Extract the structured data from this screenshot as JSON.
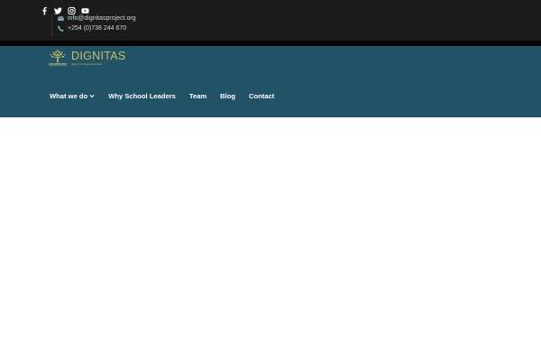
{
  "topbar": {
    "social": [
      {
        "icon": "facebook-icon"
      },
      {
        "icon": "twitter-icon"
      },
      {
        "icon": "instagram-icon"
      },
      {
        "icon": "youtube-icon"
      }
    ],
    "email": "info@dignitasproject.org",
    "phone": "+254 (0)738 244 670"
  },
  "logo": {
    "text": "DIGNITAS",
    "tagline": "dignity through education"
  },
  "nav": {
    "items": [
      "What we do",
      "Why School Leaders",
      "Team",
      "Blog",
      "Contact"
    ]
  },
  "colors": {
    "topbar_bg": "#1b1b1b",
    "header_bg": "#215266",
    "logo_gold": "#c7bf66",
    "icon_teal": "#7fc0c9"
  }
}
